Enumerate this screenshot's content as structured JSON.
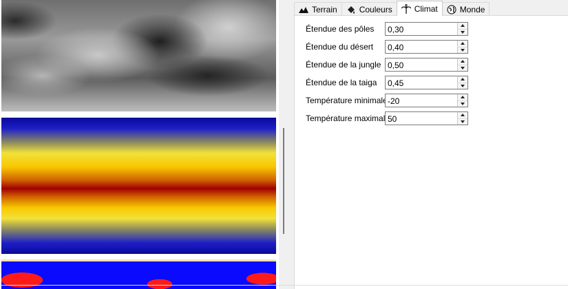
{
  "tabs": [
    {
      "label": "Terrain",
      "icon": "terrain-icon"
    },
    {
      "label": "Couleurs",
      "icon": "paint-bucket-icon"
    },
    {
      "label": "Climat",
      "icon": "palm-tree-icon",
      "active": true
    },
    {
      "label": "Monde",
      "icon": "globe-icon"
    }
  ],
  "settings": [
    {
      "label": "Étendue des pôles",
      "value": "0,30"
    },
    {
      "label": "Étendue du désert",
      "value": "0,40"
    },
    {
      "label": "Étendue de la jungle",
      "value": "0,50"
    },
    {
      "label": "Étendue de la taiga",
      "value": "0,45"
    },
    {
      "label": "Température minimale",
      "value": "-20"
    },
    {
      "label": "Température maximale",
      "value": "50"
    }
  ],
  "maps": [
    "heightmap",
    "temperature-map",
    "biome-map"
  ]
}
